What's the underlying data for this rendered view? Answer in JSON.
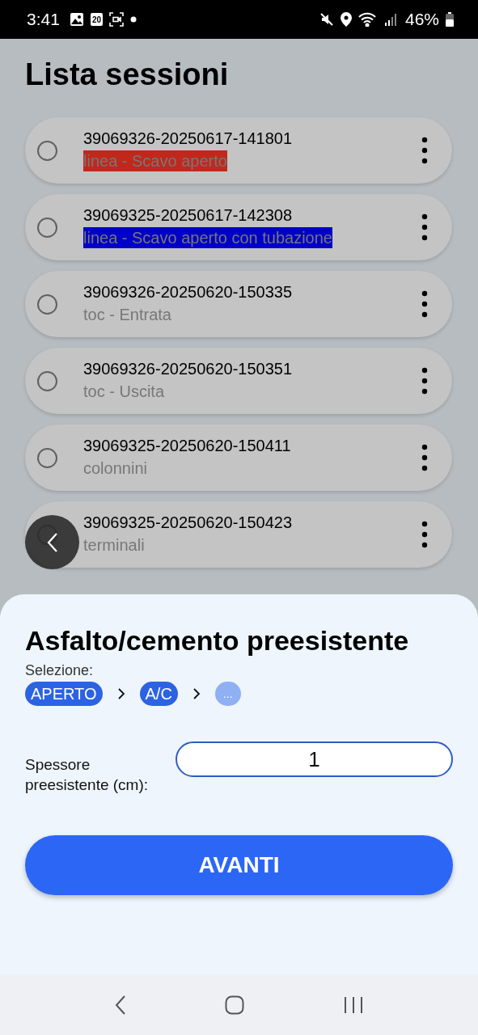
{
  "status_bar": {
    "time": "3:41",
    "calendar_day": "20",
    "battery": "46%"
  },
  "title": "Lista sessioni",
  "sessions": [
    {
      "code": "39069326-20250617-141801",
      "label": "linea - Scavo aperto",
      "color": "#c0281c",
      "selected": false
    },
    {
      "code": "39069325-20250617-142308",
      "label": "linea - Scavo aperto con tubazione",
      "color": "#0000c8",
      "selected": false
    },
    {
      "code": "39069326-20250620-150335",
      "label": "toc - Entrata",
      "selected": false
    },
    {
      "code": "39069326-20250620-150351",
      "label": "toc - Uscita",
      "selected": false
    },
    {
      "code": "39069325-20250620-150411",
      "label": "colonnini",
      "selected": false
    },
    {
      "code": "39069325-20250620-150423",
      "label": "terminali",
      "selected": false
    }
  ],
  "sheet": {
    "title": "Asfalto/cemento preesistente",
    "selection_label": "Selezione:",
    "steps": [
      {
        "label": "APERTO",
        "kind": "done"
      },
      {
        "label": "A/C",
        "kind": "done"
      },
      {
        "label": "...",
        "kind": "pending"
      }
    ],
    "field": {
      "label": "Spessore preesistente (cm):",
      "value": "1"
    },
    "button": "AVANTI"
  }
}
